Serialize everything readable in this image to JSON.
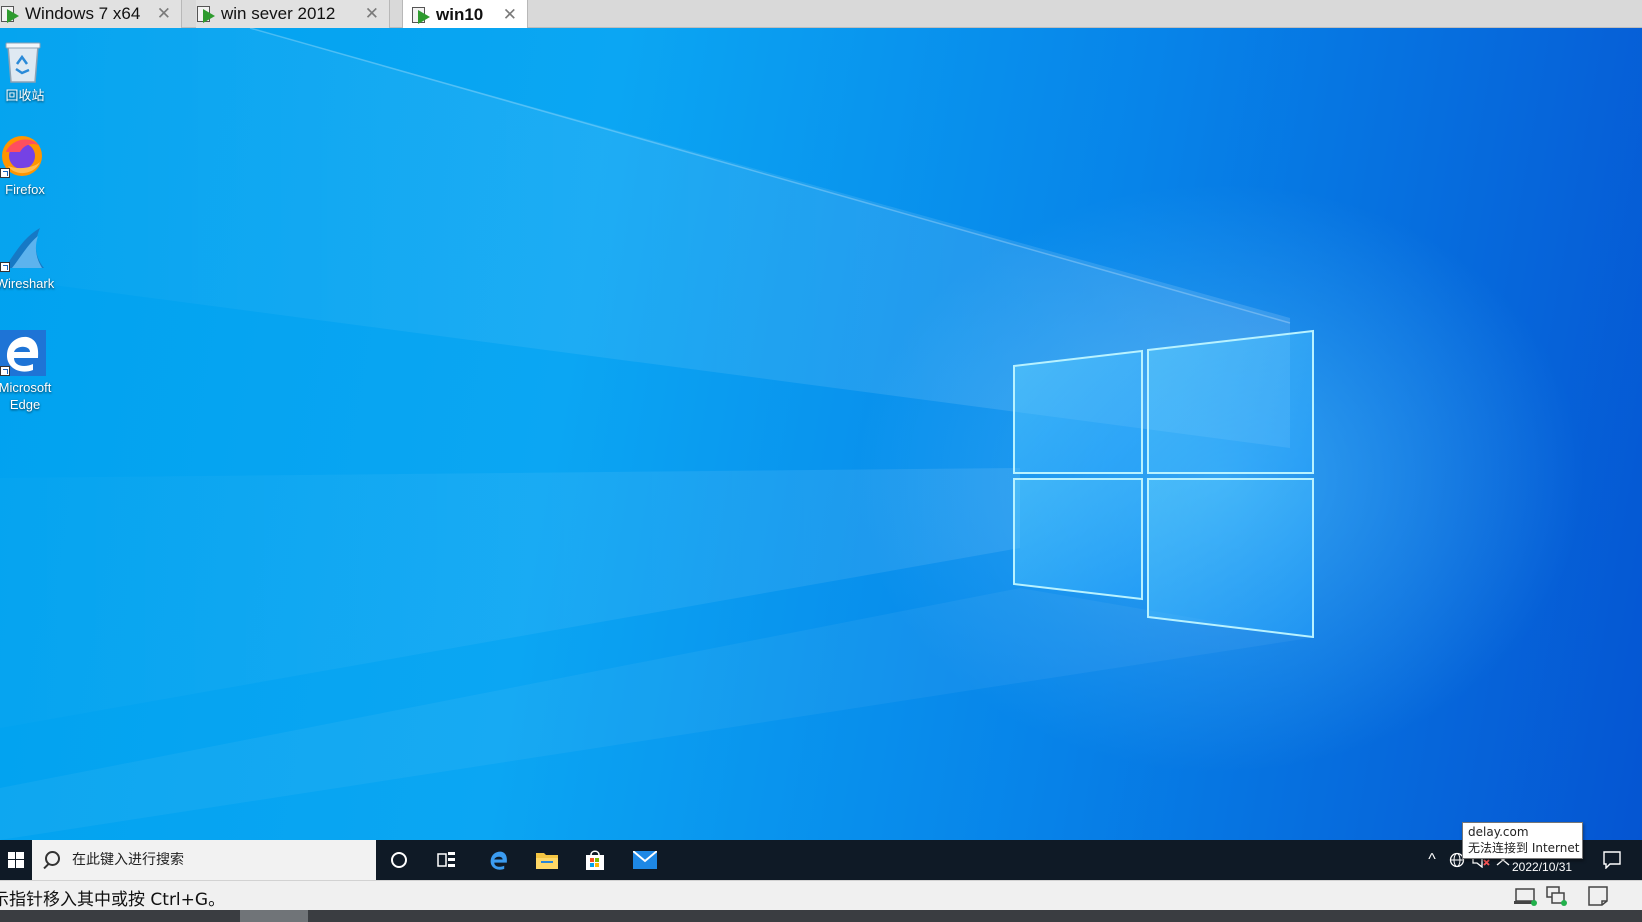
{
  "tabs": [
    {
      "label": "Windows 7 x64",
      "close": "✕",
      "active": false
    },
    {
      "label": "win sever 2012",
      "close": "✕",
      "active": false
    },
    {
      "label": "win10",
      "close": "✕",
      "active": true
    }
  ],
  "desktop": {
    "icons": [
      {
        "name": "recycle-bin",
        "label": "回收站"
      },
      {
        "name": "firefox",
        "label": "Firefox"
      },
      {
        "name": "wireshark",
        "label": "Wireshark"
      },
      {
        "name": "microsoft-edge",
        "label": "Microsoft Edge",
        "label_line1": "Microsoft",
        "label_line2": "Edge"
      }
    ]
  },
  "taskbar": {
    "search_placeholder": "在此键入进行搜索",
    "pinned": [
      "cortana-icon",
      "task-view-icon",
      "edge-icon",
      "file-explorer-icon",
      "store-icon",
      "mail-icon"
    ],
    "tray": {
      "chevron": "^",
      "date": "2022/10/31"
    },
    "network_tooltip": {
      "line1": "delay.com",
      "line2": "无法连接到 Internet"
    }
  },
  "statusbar": {
    "message": "示指针移入其中或按 Ctrl+G。"
  },
  "colors": {
    "desktop_light": "#00a2ef",
    "desktop_dark": "#0555d2",
    "taskbar": "#0f1a26",
    "tab_active": "#ffffff",
    "tab_inactive": "#e1e1e1"
  }
}
